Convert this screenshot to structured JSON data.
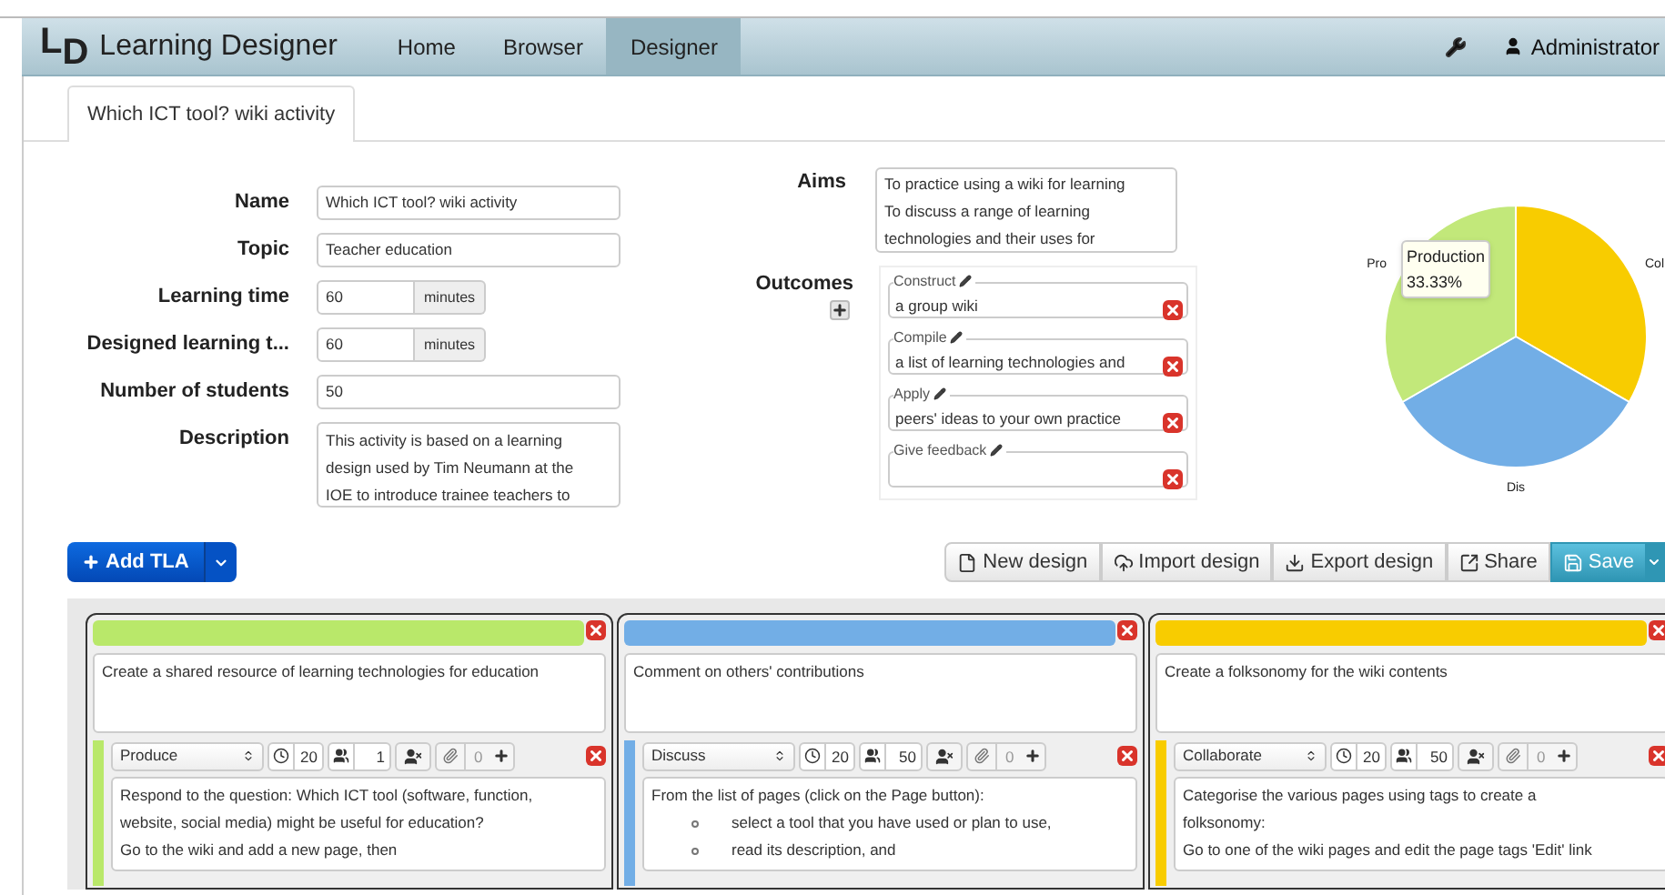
{
  "nav": {
    "logo_letters": [
      "L",
      "D"
    ],
    "brand": "Learning Designer",
    "items": [
      {
        "label": "Home",
        "selected": false
      },
      {
        "label": "Browser",
        "selected": false
      },
      {
        "label": "Designer",
        "selected": true
      }
    ],
    "user": "Administrator"
  },
  "tabs": [
    {
      "label": "Which ICT tool? wiki activity",
      "selected": true
    }
  ],
  "fields": [
    {
      "kind": "text",
      "label": "Name",
      "value": "Which ICT tool? wiki activity"
    },
    {
      "kind": "text",
      "label": "Topic",
      "value": "Teacher education"
    },
    {
      "kind": "unit",
      "label": "Learning time",
      "value": "60",
      "unit": "minutes"
    },
    {
      "kind": "unit",
      "label": "Designed learning t...",
      "value": "60",
      "unit": "minutes"
    },
    {
      "kind": "text",
      "label": "Number of students",
      "value": "50"
    },
    {
      "kind": "textarea",
      "label": "Description",
      "lines": [
        "This activity is based on a learning",
        "design used by Tim Neumann at the",
        "IOE to introduce trainee teachers to"
      ]
    }
  ],
  "aims": {
    "label": "Aims",
    "lines": [
      "To practice using a wiki for learning",
      "To discuss a range of learning",
      "technologies and their uses for"
    ]
  },
  "outcomes": {
    "label": "Outcomes",
    "items": [
      {
        "verb": "Construct",
        "text": "a group wiki"
      },
      {
        "verb": "Compile",
        "text": "a list of learning technologies and"
      },
      {
        "verb": "Apply",
        "text": "peers' ideas to your own practice"
      },
      {
        "verb": "Give feedback"
      }
    ]
  },
  "chart_data": {
    "type": "pie",
    "categories": [
      "Col",
      "Dis",
      "Pro"
    ],
    "values": [
      33.33,
      33.33,
      33.33
    ],
    "colors": [
      "#f8cc00",
      "#72aee6",
      "#c2e87a"
    ],
    "annotations": [
      {
        "text": "Production"
      },
      {
        "text": "33.33%"
      }
    ]
  },
  "add_button": "Add TLA",
  "toolbar": [
    {
      "kind": "new",
      "label": "New design"
    },
    {
      "kind": "import",
      "label": "Import design"
    },
    {
      "kind": "export",
      "label": "Export design"
    },
    {
      "kind": "share",
      "label": "Share"
    },
    {
      "kind": "save",
      "label": "Save"
    }
  ],
  "tlas": [
    {
      "color": "#b9e86a",
      "title": "Create a shared resource of learning technologies for education",
      "activity": {
        "type": "Produce",
        "duration": "20",
        "group_size": "1",
        "attachments": "0",
        "lines": [
          {
            "kind": "text",
            "text": "Respond to the question: Which ICT tool (software, function,"
          },
          {
            "kind": "text",
            "text": "website, social media) might be useful for education?"
          },
          {
            "kind": "text",
            "text": "Go to the wiki and add a new page, then"
          }
        ]
      }
    },
    {
      "color": "#72aee6",
      "title": "Comment on others' contributions",
      "activity": {
        "type": "Discuss",
        "duration": "20",
        "group_size": "50",
        "attachments": "0",
        "lines": [
          {
            "kind": "text",
            "text": "From the list of pages (click on the Page button):"
          },
          {
            "kind": "bullet",
            "text": "select a tool that you have used or plan to use,"
          },
          {
            "kind": "bullet",
            "text": "read its description, and"
          }
        ]
      }
    },
    {
      "color": "#f8cc00",
      "title": "Create a folksonomy for the wiki contents",
      "activity": {
        "type": "Collaborate",
        "duration": "20",
        "group_size": "50",
        "attachments": "0",
        "lines": [
          {
            "kind": "text",
            "text": "Categorise the various pages using tags to create a"
          },
          {
            "kind": "text",
            "text": "folksonomy:"
          },
          {
            "kind": "text",
            "text": "Go to one of the wiki pages and edit the page tags 'Edit' link"
          }
        ]
      }
    }
  ]
}
